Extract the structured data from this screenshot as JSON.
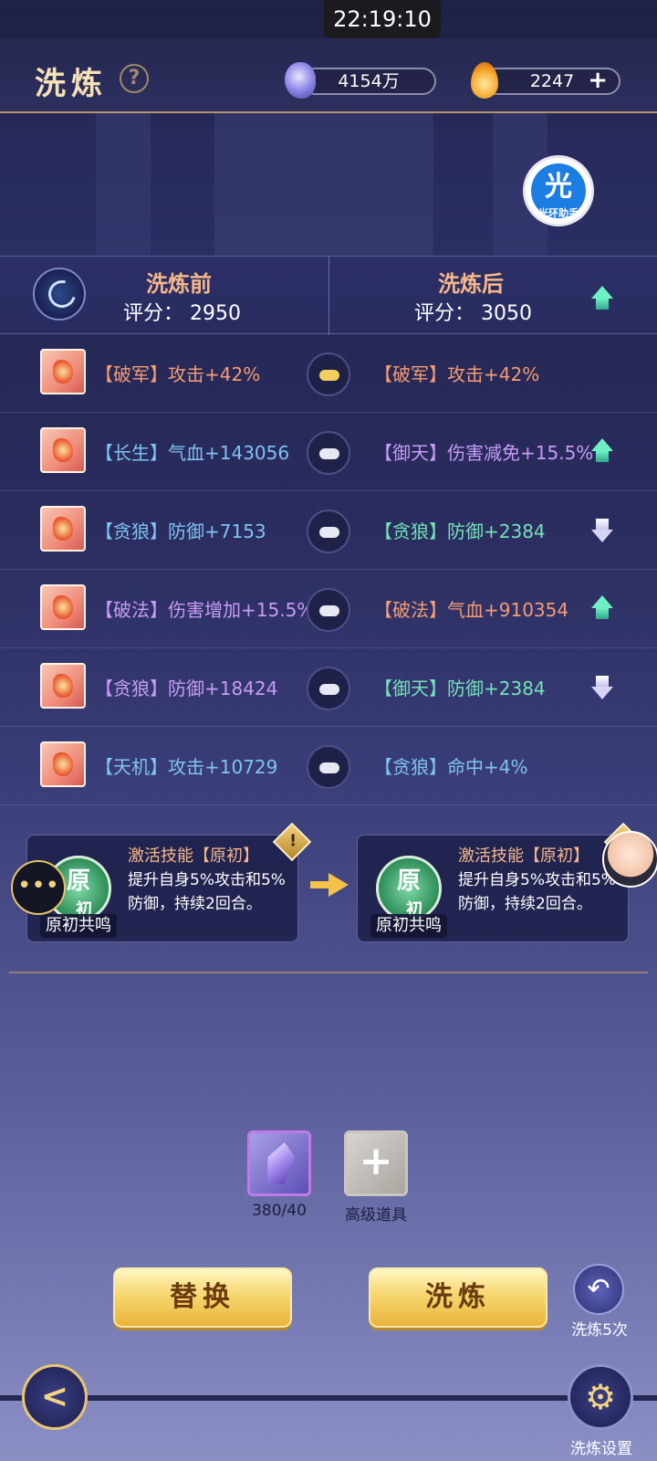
{
  "status": {
    "time": "22:19:10"
  },
  "header": {
    "title": "洗炼",
    "help_glyph": "?",
    "currency1": {
      "value": "4154万",
      "icon": "crystal-gem-icon"
    },
    "currency2": {
      "value": "2247",
      "icon": "flame-drop-icon",
      "add_glyph": "+"
    }
  },
  "helper": {
    "badge_char": "光",
    "label": "光环助手"
  },
  "compare": {
    "before": {
      "title": "洗炼前",
      "score_label": "评分：",
      "score": "2950"
    },
    "after": {
      "title": "洗炼后",
      "score_label": "评分：",
      "score": "3050",
      "trend": "up"
    }
  },
  "rows": [
    {
      "left": {
        "tag": "【破军】",
        "stat": "攻击+42%",
        "color": "orange"
      },
      "lock": "gold",
      "right": {
        "tag": "【破军】",
        "stat": "攻击+42%",
        "color": "orange"
      },
      "trend": ""
    },
    {
      "left": {
        "tag": "【长生】",
        "stat": "气血+143056",
        "color": "blue"
      },
      "lock": "white",
      "right": {
        "tag": "【御天】",
        "stat": "伤害减免+15.5%",
        "color": "purple"
      },
      "trend": "up"
    },
    {
      "left": {
        "tag": "【贪狼】",
        "stat": "防御+7153",
        "color": "blue"
      },
      "lock": "white",
      "right": {
        "tag": "【贪狼】",
        "stat": "防御+2384",
        "color": "green"
      },
      "trend": "down"
    },
    {
      "left": {
        "tag": "【破法】",
        "stat": "伤害增加+15.5%",
        "color": "purple"
      },
      "lock": "white",
      "right": {
        "tag": "【破法】",
        "stat": "气血+910354",
        "color": "orange"
      },
      "trend": "up"
    },
    {
      "left": {
        "tag": "【贪狼】",
        "stat": "防御+18424",
        "color": "purple"
      },
      "lock": "white",
      "right": {
        "tag": "【御天】",
        "stat": "防御+2384",
        "color": "green"
      },
      "trend": "down"
    },
    {
      "left": {
        "tag": "【天机】",
        "stat": "攻击+10729",
        "color": "blue"
      },
      "lock": "white",
      "right": {
        "tag": "【贪狼】",
        "stat": "命中+4%",
        "color": "blue"
      },
      "trend": ""
    }
  ],
  "skills": {
    "before": {
      "emblem": "原",
      "emblem_sub": "初",
      "name": "原初共鸣",
      "title": "激活技能【原初】",
      "desc": "提升自身5%攻击和5%防御，持续2回合。"
    },
    "after": {
      "emblem": "原",
      "emblem_sub": "初",
      "name": "原初共鸣",
      "title": "激活技能【原初】",
      "desc": "提升自身5%攻击和5%防御，持续2回合。"
    },
    "warn_glyph": "!"
  },
  "items": {
    "crystal": {
      "count": "380/40",
      "icon": "purple-crystal-icon"
    },
    "advanced": {
      "label": "高级道具",
      "glyph": "+"
    }
  },
  "buttons": {
    "replace": "替换",
    "refine": "洗炼",
    "refine5": "洗炼5次",
    "settings": "洗炼设置"
  },
  "colors": {
    "orange": "#f59c73",
    "blue": "#7fc3f2",
    "purple": "#c79cf5",
    "green": "#74e2b9",
    "gold": "#f3d57f"
  }
}
